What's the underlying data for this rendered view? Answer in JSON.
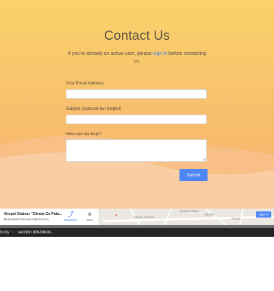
{
  "contact": {
    "title": "Contact Us",
    "intro_before": "If you're already an active user, please ",
    "intro_link": "sign in",
    "intro_after": " before contacting us.",
    "email_label": "Your Email Address",
    "email_value": "",
    "subject_label": "Subject (optional but helpful)",
    "subject_value": "",
    "message_label": "How can we help?",
    "message_value": "",
    "submit_label": "Submit",
    "colors": {
      "gradient_top": "#f9d36a",
      "gradient_bottom": "#f5b070",
      "link": "#3f7ee8",
      "submit": "#4f86f7"
    }
  },
  "map": {
    "place_name": "Grupul Statuar \"Căruța Cu Paia...",
    "place_address": "Bulevardul Nicolae Bălcescu 5,",
    "directions_label": "Directions",
    "save_label": "Save",
    "signin_label": "Sign in",
    "streets": [
      "Strada Halade",
      "Zalomit",
      "Strada Zalomit",
      "Strada"
    ]
  },
  "devtools": {
    "breadcrumbs": [
      "body",
      "section.fdb-block..."
    ]
  }
}
